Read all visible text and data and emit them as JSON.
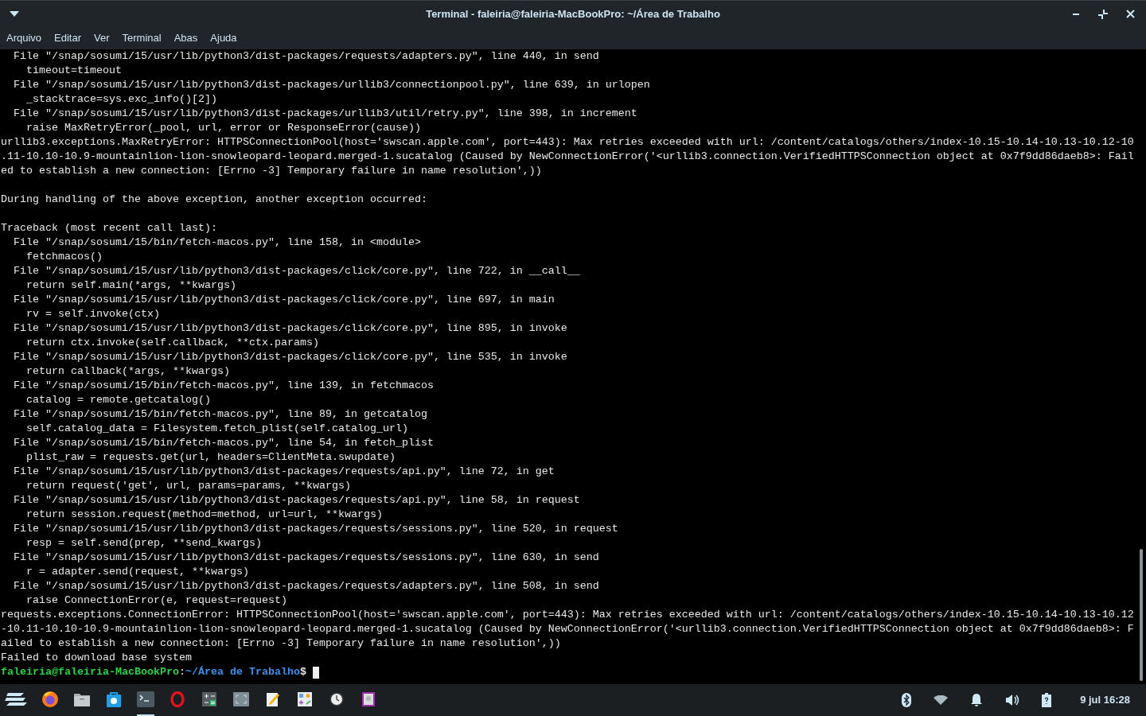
{
  "window": {
    "title": "Terminal - faleiria@faleiria-MacBookPro: ~/Área de Trabalho"
  },
  "menu": [
    "Arquivo",
    "Editar",
    "Ver",
    "Terminal",
    "Abas",
    "Ajuda"
  ],
  "terminal": {
    "blocks": [
      [
        "  File \"/snap/sosumi/15/usr/lib/python3/dist-packages/requests/adapters.py\", line 440, in send",
        "    timeout=timeout",
        "  File \"/snap/sosumi/15/usr/lib/python3/dist-packages/urllib3/connectionpool.py\", line 639, in urlopen",
        "    _stacktrace=sys.exc_info()[2])",
        "  File \"/snap/sosumi/15/usr/lib/python3/dist-packages/urllib3/util/retry.py\", line 398, in increment",
        "    raise MaxRetryError(_pool, url, error or ResponseError(cause))",
        "urllib3.exceptions.MaxRetryError: HTTPSConnectionPool(host='swscan.apple.com', port=443): Max retries exceeded with url: /content/catalogs/others/index-10.15-10.14-10.13-10.12-10",
        ".11-10.10-10.9-mountainlion-lion-snowleopard-leopard.merged-1.sucatalog (Caused by NewConnectionError('<urllib3.connection.VerifiedHTTPSConnection object at 0x7f9dd86daeb8>: Fail",
        "ed to establish a new connection: [Errno -3] Temporary failure in name resolution',))"
      ],
      [
        "During handling of the above exception, another exception occurred:"
      ],
      [
        "Traceback (most recent call last):",
        "  File \"/snap/sosumi/15/bin/fetch-macos.py\", line 158, in <module>",
        "    fetchmacos()",
        "  File \"/snap/sosumi/15/usr/lib/python3/dist-packages/click/core.py\", line 722, in __call__",
        "    return self.main(*args, **kwargs)",
        "  File \"/snap/sosumi/15/usr/lib/python3/dist-packages/click/core.py\", line 697, in main",
        "    rv = self.invoke(ctx)",
        "  File \"/snap/sosumi/15/usr/lib/python3/dist-packages/click/core.py\", line 895, in invoke",
        "    return ctx.invoke(self.callback, **ctx.params)",
        "  File \"/snap/sosumi/15/usr/lib/python3/dist-packages/click/core.py\", line 535, in invoke",
        "    return callback(*args, **kwargs)",
        "  File \"/snap/sosumi/15/bin/fetch-macos.py\", line 139, in fetchmacos",
        "    catalog = remote.getcatalog()",
        "  File \"/snap/sosumi/15/bin/fetch-macos.py\", line 89, in getcatalog",
        "    self.catalog_data = Filesystem.fetch_plist(self.catalog_url)",
        "  File \"/snap/sosumi/15/bin/fetch-macos.py\", line 54, in fetch_plist",
        "    plist_raw = requests.get(url, headers=ClientMeta.swupdate)",
        "  File \"/snap/sosumi/15/usr/lib/python3/dist-packages/requests/api.py\", line 72, in get",
        "    return request('get', url, params=params, **kwargs)",
        "  File \"/snap/sosumi/15/usr/lib/python3/dist-packages/requests/api.py\", line 58, in request",
        "    return session.request(method=method, url=url, **kwargs)",
        "  File \"/snap/sosumi/15/usr/lib/python3/dist-packages/requests/sessions.py\", line 520, in request",
        "    resp = self.send(prep, **send_kwargs)",
        "  File \"/snap/sosumi/15/usr/lib/python3/dist-packages/requests/sessions.py\", line 630, in send",
        "    r = adapter.send(request, **kwargs)",
        "  File \"/snap/sosumi/15/usr/lib/python3/dist-packages/requests/adapters.py\", line 508, in send",
        "    raise ConnectionError(e, request=request)",
        "requests.exceptions.ConnectionError: HTTPSConnectionPool(host='swscan.apple.com', port=443): Max retries exceeded with url: /content/catalogs/others/index-10.15-10.14-10.13-10.12",
        "-10.11-10.10-10.9-mountainlion-lion-snowleopard-leopard.merged-1.sucatalog (Caused by NewConnectionError('<urllib3.connection.VerifiedHTTPSConnection object at 0x7f9dd86daeb8>: F",
        "ailed to establish a new connection: [Errno -3] Temporary failure in name resolution',))",
        "Failed to download base system"
      ]
    ],
    "prompt": {
      "user_host": "faleiria@faleiria-MacBookPro",
      "separator": ":",
      "path": "~/Área de Trabalho",
      "symbol": "$"
    }
  },
  "taskbar": {
    "apps": [
      {
        "kind": "menu",
        "selected": false
      },
      {
        "kind": "firefox",
        "selected": false
      },
      {
        "kind": "files",
        "selected": false
      },
      {
        "kind": "store",
        "selected": false
      },
      {
        "kind": "terminal",
        "selected": true
      },
      {
        "kind": "opera",
        "selected": false
      },
      {
        "kind": "calculator",
        "selected": false
      },
      {
        "kind": "screenshot",
        "selected": false
      },
      {
        "kind": "editor",
        "selected": false
      },
      {
        "kind": "settings",
        "selected": false
      },
      {
        "kind": "clock",
        "selected": false
      },
      {
        "kind": "viewer",
        "selected": false
      }
    ],
    "clock": "9 jul 16:28"
  }
}
